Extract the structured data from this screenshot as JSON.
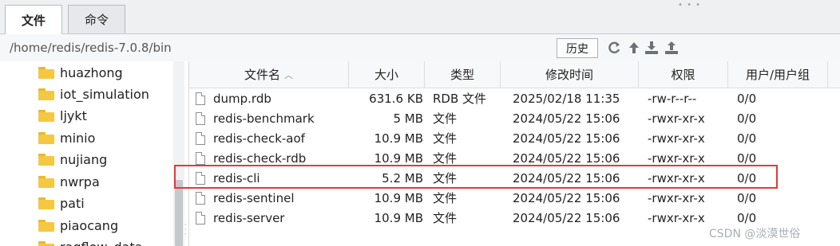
{
  "tabs": [
    {
      "label": "文件",
      "active": true
    },
    {
      "label": "命令",
      "active": false
    }
  ],
  "path": "/home/redis/redis-7.0.8/bin",
  "history_label": "历史",
  "toolbar_icons": [
    "refresh-icon",
    "upload-arrow-icon",
    "download-icon",
    "upload-icon"
  ],
  "tree": {
    "items": [
      "huazhong",
      "iot_simulation",
      "ljykt",
      "minio",
      "nujiang",
      "nwrpa",
      "pati",
      "piaocang",
      "ragflow_data"
    ]
  },
  "table": {
    "columns": [
      "文件名",
      "大小",
      "类型",
      "修改时间",
      "权限",
      "用户/用户组"
    ],
    "rows": [
      {
        "name": "dump.rdb",
        "size": "631.6 KB",
        "type": "RDB 文件",
        "time": "2025/02/18 11:35",
        "perm": "-rw-r--r--",
        "owner": "0/0"
      },
      {
        "name": "redis-benchmark",
        "size": "5 MB",
        "type": "文件",
        "time": "2024/05/22 15:06",
        "perm": "-rwxr-xr-x",
        "owner": "0/0"
      },
      {
        "name": "redis-check-aof",
        "size": "10.9 MB",
        "type": "文件",
        "time": "2024/05/22 15:06",
        "perm": "-rwxr-xr-x",
        "owner": "0/0"
      },
      {
        "name": "redis-check-rdb",
        "size": "10.9 MB",
        "type": "文件",
        "time": "2024/05/22 15:06",
        "perm": "-rwxr-xr-x",
        "owner": "0/0"
      },
      {
        "name": "redis-cli",
        "size": "5.2 MB",
        "type": "文件",
        "time": "2024/05/22 15:06",
        "perm": "-rwxr-xr-x",
        "owner": "0/0",
        "highlighted": true
      },
      {
        "name": "redis-sentinel",
        "size": "10.9 MB",
        "type": "文件",
        "time": "2024/05/22 15:06",
        "perm": "-rwxr-xr-x",
        "owner": "0/0"
      },
      {
        "name": "redis-server",
        "size": "10.9 MB",
        "type": "文件",
        "time": "2024/05/22 15:06",
        "perm": "-rwxr-xr-x",
        "owner": "0/0"
      }
    ]
  },
  "watermark": "CSDN @淡漠世俗",
  "colors": {
    "highlight_border": "#e03b3b",
    "folder": "#f5c842"
  }
}
